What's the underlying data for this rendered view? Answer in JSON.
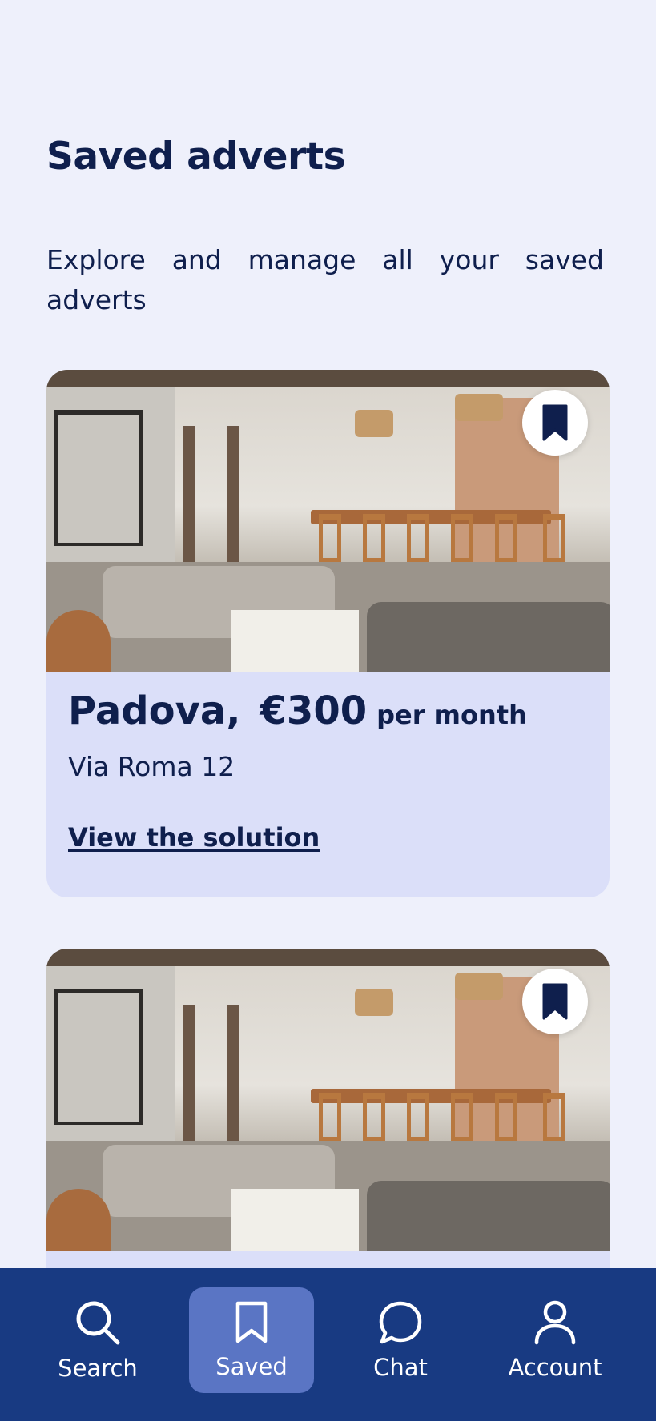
{
  "header": {
    "title": "Saved adverts",
    "subtitle": "Explore and manage all your saved adverts"
  },
  "adverts": [
    {
      "city": "Padova,",
      "price": "€300",
      "price_suffix": "per month",
      "address": "Via Roma 12",
      "link_label": "View the solution",
      "saved": true,
      "bookmark_icon": "bookmark-filled-icon"
    },
    {
      "saved": true,
      "bookmark_icon": "bookmark-filled-icon"
    }
  ],
  "navbar": {
    "active": "Saved",
    "items": [
      {
        "label": "Search",
        "icon": "search-icon"
      },
      {
        "label": "Saved",
        "icon": "bookmark-icon"
      },
      {
        "label": "Chat",
        "icon": "chat-bubble-icon"
      },
      {
        "label": "Account",
        "icon": "user-icon"
      }
    ]
  },
  "colors": {
    "background": "#eef0fb",
    "card": "#dbdff9",
    "text": "#0f1f4d",
    "navbar": "#183a82",
    "nav_active": "#5a75c4"
  }
}
